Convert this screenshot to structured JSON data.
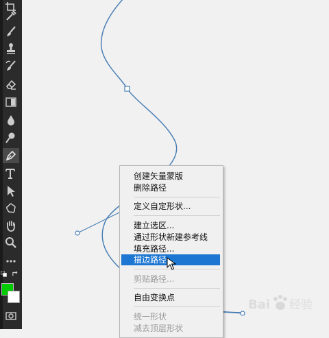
{
  "colors": {
    "foreground": "#00cc00",
    "background": "#ffffff",
    "path": "#4a7fb5",
    "highlight": "#1c76d2"
  },
  "toolbar": {
    "tools": [
      {
        "name": "crop-icon"
      },
      {
        "name": "eyedropper-icon"
      },
      {
        "name": "healing-brush-icon"
      },
      {
        "name": "brush-icon"
      },
      {
        "name": "clone-stamp-icon"
      },
      {
        "name": "history-brush-icon"
      },
      {
        "name": "eraser-icon"
      },
      {
        "name": "gradient-icon"
      },
      {
        "name": "blur-icon"
      },
      {
        "name": "dodge-icon"
      },
      {
        "name": "pen-icon"
      },
      {
        "name": "type-icon"
      },
      {
        "name": "path-selection-icon"
      },
      {
        "name": "custom-shape-icon"
      },
      {
        "name": "hand-icon"
      },
      {
        "name": "zoom-icon"
      },
      {
        "name": "more-tools-icon"
      }
    ],
    "active_tool": "pen-icon"
  },
  "context_menu": {
    "items": [
      {
        "label": "创建矢量蒙版",
        "enabled": true
      },
      {
        "label": "删除路径",
        "enabled": true
      },
      {
        "label": "定义自定形状...",
        "enabled": true
      },
      {
        "label": "建立选区...",
        "enabled": true
      },
      {
        "label": "通过形状新建参考线",
        "enabled": true
      },
      {
        "label": "填充路径...",
        "enabled": true
      },
      {
        "label": "描边路径...",
        "enabled": true,
        "highlighted": true
      },
      {
        "label": "剪贴路径...",
        "enabled": false
      },
      {
        "label": "自由变换点",
        "enabled": true
      },
      {
        "label": "统一形状",
        "enabled": false
      },
      {
        "label": "减去顶层形状",
        "enabled": false
      }
    ]
  },
  "watermark": {
    "text": "Bai 经验"
  }
}
